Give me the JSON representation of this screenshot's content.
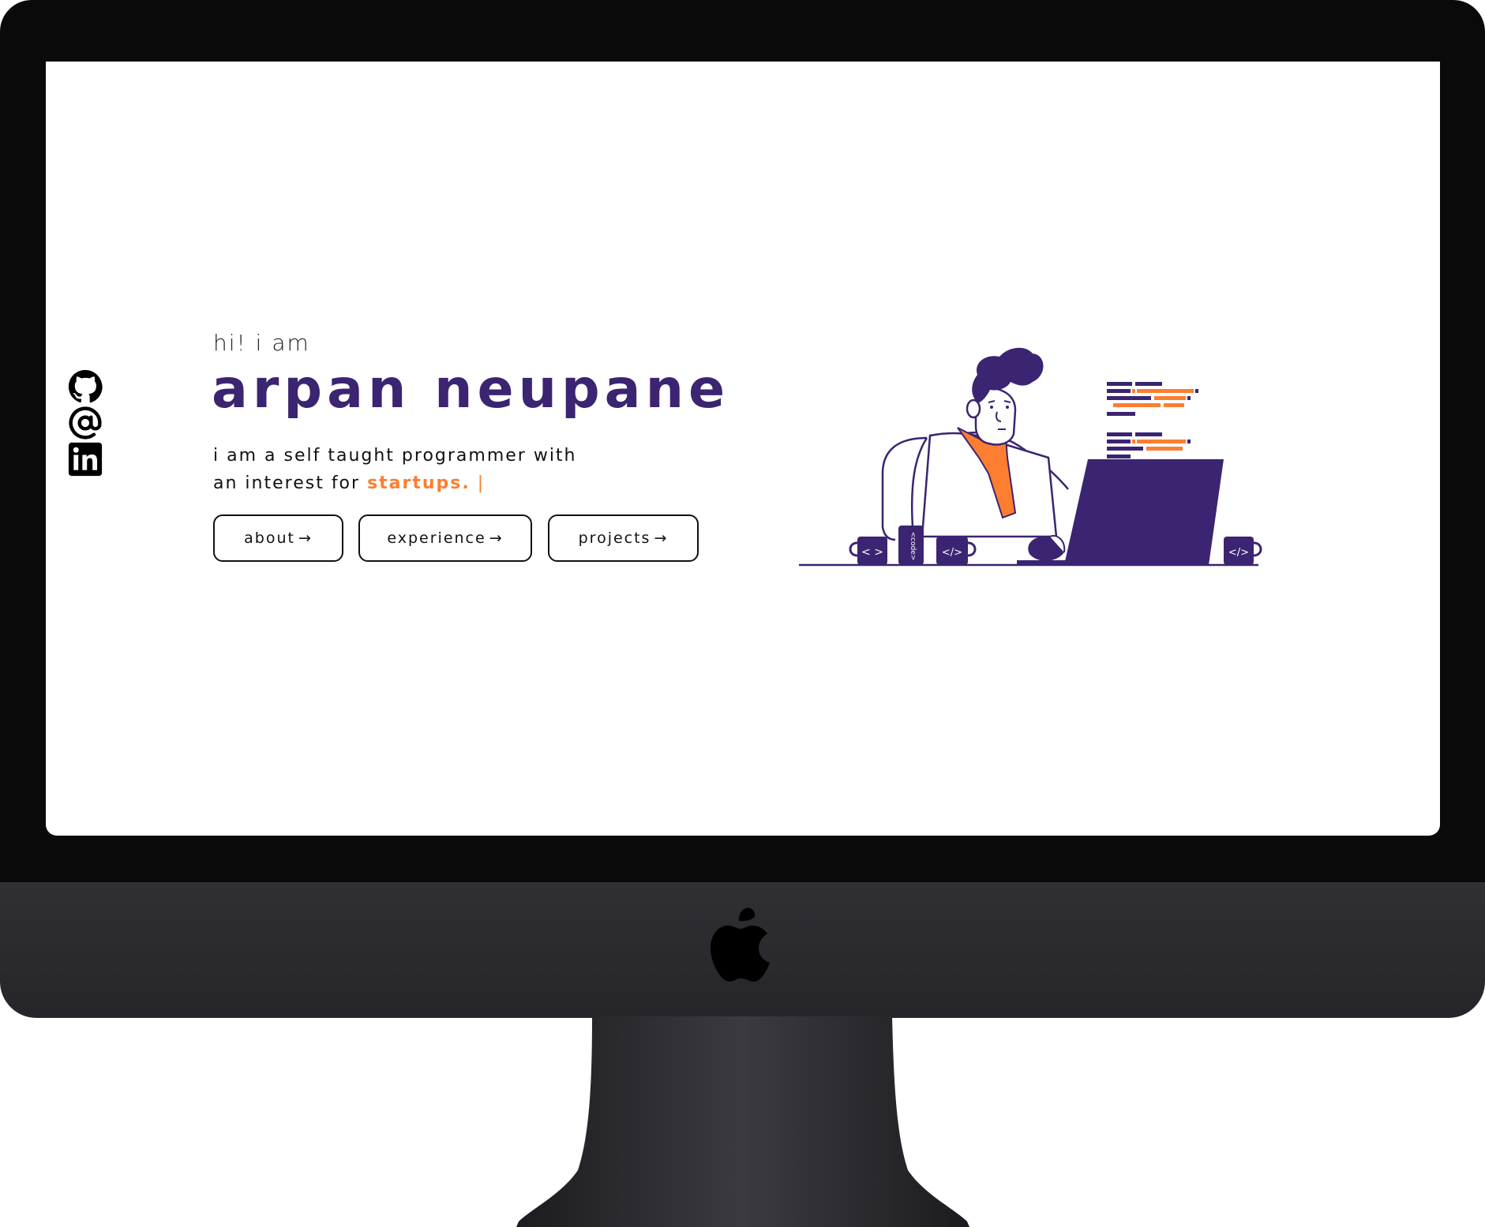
{
  "hero": {
    "greeting": "hi! i am",
    "name": "arpan neupane",
    "tagline_line1": "i am a self taught programmer with",
    "tagline_prefix": "an interest for ",
    "tagline_highlight": "startups.",
    "tagline_cursor": "|"
  },
  "nav_buttons": [
    {
      "label": "about",
      "arrow": "→"
    },
    {
      "label": "experience",
      "arrow": "→"
    },
    {
      "label": "projects",
      "arrow": "→"
    }
  ],
  "socials": [
    {
      "icon": "github-icon"
    },
    {
      "icon": "at-sign-icon"
    },
    {
      "icon": "linkedin-icon"
    }
  ],
  "colors": {
    "accent_purple": "#3b2471",
    "accent_orange": "#fd7e30",
    "bezel": "#0a0a0a",
    "chin": "#2f2f34"
  }
}
